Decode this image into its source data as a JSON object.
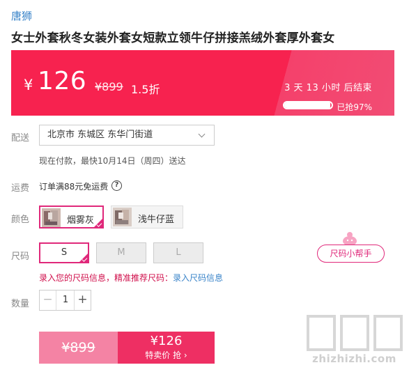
{
  "brand": "唐狮",
  "title": "女士外套秋冬女装外套女短款立领牛仔拼接羔绒外套厚外套女",
  "price_banner": {
    "currency": "¥",
    "price": "126",
    "original_price": "¥899",
    "discount": "1.5折",
    "countdown": "3 天 13 小时 后结束",
    "sold_percent": 97,
    "sold_label": "已抢97%"
  },
  "delivery": {
    "label": "配送",
    "address": "北京市 东城区 东华门街道",
    "note": "现在付款，最快10月14日（周四）送达"
  },
  "shipping": {
    "label": "运费",
    "text": "订单满88元免运费",
    "help_glyph": "?"
  },
  "color": {
    "label": "颜色",
    "options": [
      {
        "name": "烟雾灰",
        "selected": true
      },
      {
        "name": "浅牛仔蓝",
        "selected": false
      }
    ]
  },
  "size": {
    "label": "尺码",
    "options": [
      {
        "name": "S",
        "selected": true
      },
      {
        "name": "M",
        "selected": false
      },
      {
        "name": "L",
        "selected": false
      }
    ],
    "helper": "尺码小帮手",
    "hint": "录入您的尺码信息，精准推荐尺码：",
    "hint_link": "录入尺码信息"
  },
  "quantity": {
    "label": "数量",
    "value": "1",
    "minus": "−",
    "plus": "+"
  },
  "buy": {
    "original_price": "¥899",
    "price": "¥126",
    "label": "特卖价 抢 ›"
  },
  "watermark": {
    "text": "zhizhizhi.com"
  },
  "colors": {
    "accent": "#f7224f",
    "brand_link": "#3a84c9",
    "selected_border": "#e0287a",
    "buy_button": "#ee2f63",
    "buy_original": "#f483a4"
  }
}
